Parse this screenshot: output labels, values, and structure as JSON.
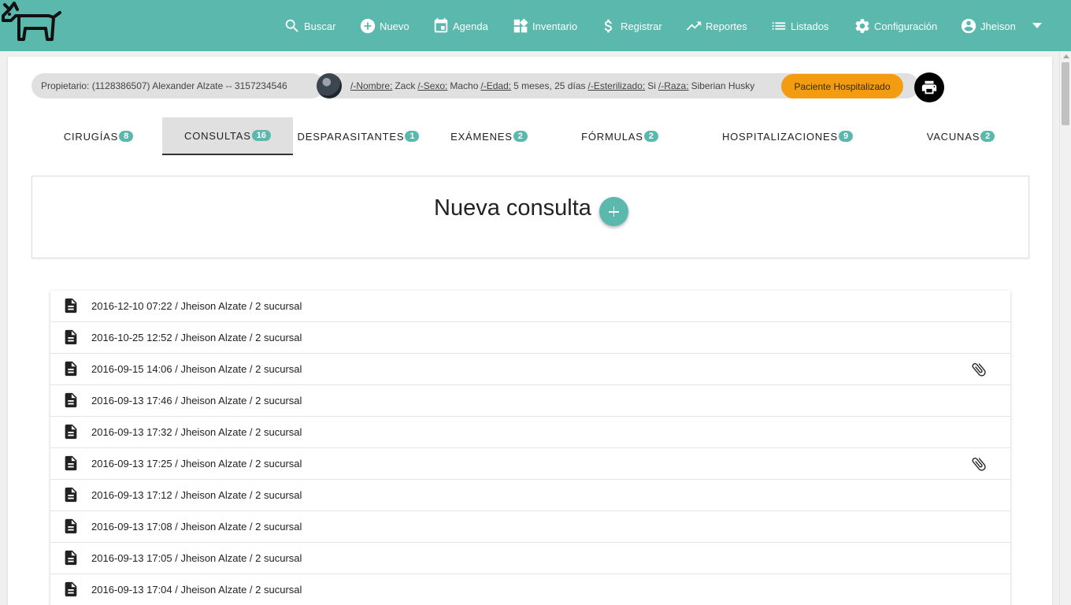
{
  "nav": {
    "items": [
      {
        "label": "Buscar",
        "icon": "search-icon"
      },
      {
        "label": "Nuevo",
        "icon": "add-circle-icon"
      },
      {
        "label": "Agenda",
        "icon": "calendar-icon"
      },
      {
        "label": "Inventario",
        "icon": "inventory-icon"
      },
      {
        "label": "Registrar",
        "icon": "dollar-icon"
      },
      {
        "label": "Reportes",
        "icon": "trending-icon"
      },
      {
        "label": "Listados",
        "icon": "list-icon"
      },
      {
        "label": "Configuración",
        "icon": "gear-icon"
      },
      {
        "label": "Jheison",
        "icon": "account-icon"
      }
    ],
    "background": "#5bb8ad"
  },
  "patient": {
    "owner": "Propietario: (1128386507) Alexander Alzate -- 3157234546",
    "fields": [
      {
        "label": "/-Nombre:",
        "value": "Zack"
      },
      {
        "label": "/-Sexo:",
        "value": "Macho"
      },
      {
        "label": "/-Edad:",
        "value": "5 meses, 25 días"
      },
      {
        "label": "/-Esterilizado:",
        "value": "Si"
      },
      {
        "label": "/-Raza:",
        "value": "Siberian Husky"
      }
    ],
    "status": "Paciente Hospitalizado",
    "status_color": "#f39c12"
  },
  "tabs": [
    {
      "label": "CIRUGÍAS",
      "count": "8",
      "active": false
    },
    {
      "label": "CONSULTAS",
      "count": "16",
      "active": true
    },
    {
      "label": "DESPARASITANTES",
      "count": "1",
      "active": false
    },
    {
      "label": "EXÁMENES",
      "count": "2",
      "active": false
    },
    {
      "label": "FÓRMULAS",
      "count": "2",
      "active": false
    },
    {
      "label": "HOSPITALIZACIONES",
      "count": "9",
      "active": false
    },
    {
      "label": "VACUNAS",
      "count": "2",
      "active": false
    }
  ],
  "new_consult": {
    "title": "Nueva consulta"
  },
  "consults": [
    {
      "text": "2016-12-10 07:22 / Jheison Alzate / 2 sucursal",
      "attachment": false
    },
    {
      "text": "2016-10-25 12:52 / Jheison Alzate / 2 sucursal",
      "attachment": false
    },
    {
      "text": "2016-09-15 14:06 / Jheison Alzate / 2 sucursal",
      "attachment": true
    },
    {
      "text": "2016-09-13 17:46 / Jheison Alzate / 2 sucursal",
      "attachment": false
    },
    {
      "text": "2016-09-13 17:32 / Jheison Alzate / 2 sucursal",
      "attachment": false
    },
    {
      "text": "2016-09-13 17:25 / Jheison Alzate / 2 sucursal",
      "attachment": true
    },
    {
      "text": "2016-09-13 17:12 / Jheison Alzate / 2 sucursal",
      "attachment": false
    },
    {
      "text": "2016-09-13 17:08 / Jheison Alzate / 2 sucursal",
      "attachment": false
    },
    {
      "text": "2016-09-13 17:05 / Jheison Alzate / 2 sucursal",
      "attachment": false
    },
    {
      "text": "2016-09-13 17:04 / Jheison Alzate / 2 sucursal",
      "attachment": false
    }
  ]
}
